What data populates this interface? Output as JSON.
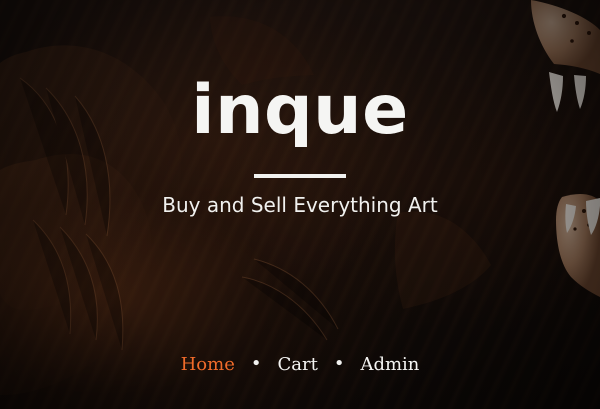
{
  "site": {
    "brand": "inque",
    "tagline": "Buy and Sell Everything Art"
  },
  "navigation": {
    "items": [
      {
        "label": "Home",
        "active": true
      },
      {
        "label": "Cart",
        "active": false
      },
      {
        "label": "Admin",
        "active": false
      }
    ],
    "separator": "•"
  },
  "colors": {
    "accent": "#f06b2a",
    "text_primary": "#f5f5f3",
    "background_dark": "#0d0907"
  },
  "icons": {
    "background": "artwork-background-icon"
  }
}
